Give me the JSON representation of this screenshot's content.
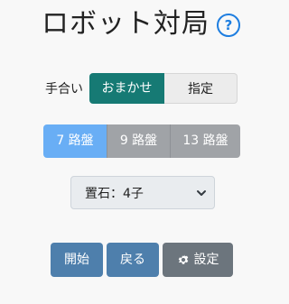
{
  "header": {
    "title": "ロボット対局",
    "help_icon": "question-circle-icon"
  },
  "mode": {
    "label": "手合い",
    "options": [
      "おまかせ",
      "指定"
    ],
    "selected": "おまかせ"
  },
  "board_sizes": {
    "options": [
      "7 路盤",
      "9 路盤",
      "13 路盤"
    ],
    "selected": "7 路盤"
  },
  "handicap": {
    "selected": "置石：4子"
  },
  "actions": {
    "start": "開始",
    "back": "戻る",
    "settings": "設定"
  },
  "colors": {
    "primary_teal": "#167a74",
    "active_blue": "#69aef5",
    "button_blue": "#4e7fac",
    "button_gray": "#6c757d",
    "help_blue": "#1e7ee0"
  }
}
